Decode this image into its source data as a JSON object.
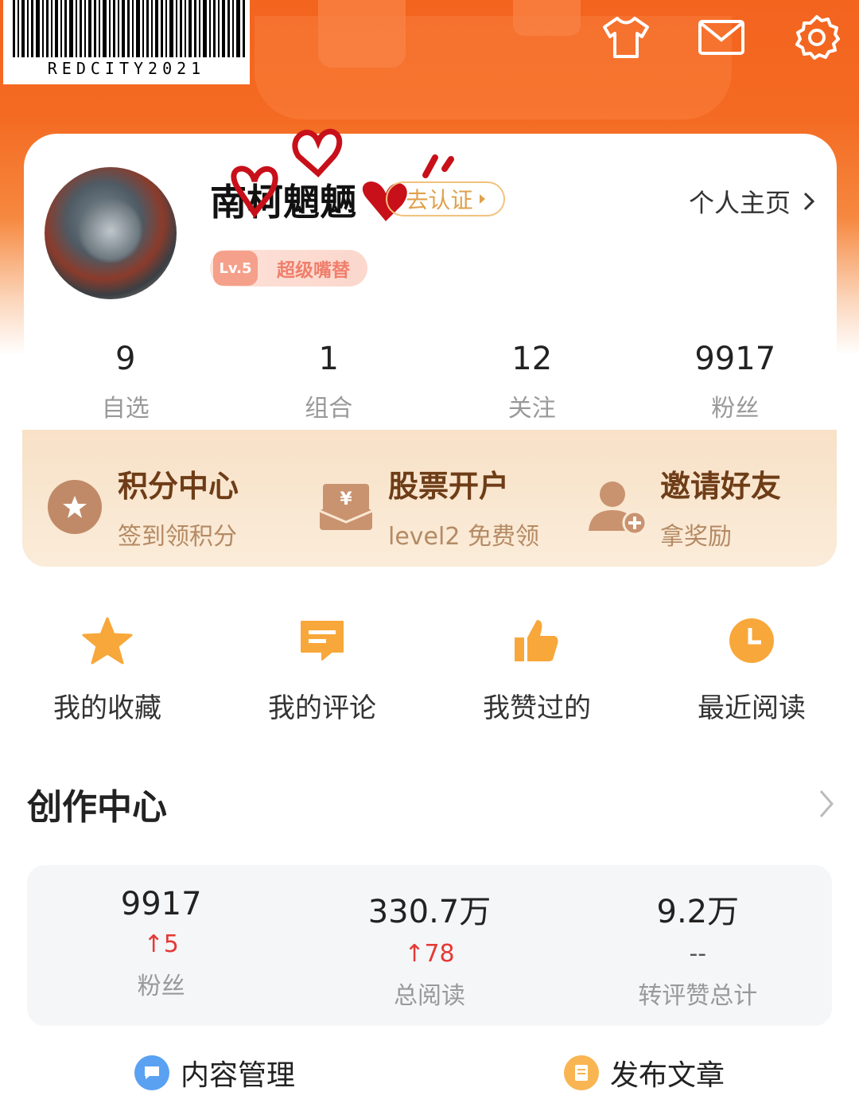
{
  "barcode": {
    "text": "REDCITY2021"
  },
  "header": {
    "icons": [
      "shirt-icon",
      "mail-icon",
      "settings-icon"
    ]
  },
  "profile": {
    "name": "南柯魍魉",
    "verify_label": "去认证",
    "homepage_label": "个人主页",
    "level": "Lv.5",
    "level_title": "超级嘴替"
  },
  "stats": [
    {
      "value": "9",
      "label": "自选"
    },
    {
      "value": "1",
      "label": "组合"
    },
    {
      "value": "12",
      "label": "关注"
    },
    {
      "value": "9917",
      "label": "粉丝"
    }
  ],
  "promos": [
    {
      "title": "积分中心",
      "subtitle": "签到领积分"
    },
    {
      "title": "股票开户",
      "subtitle": "level2 免费领"
    },
    {
      "title": "邀请好友",
      "subtitle": "拿奖励"
    }
  ],
  "quick_actions": [
    {
      "label": "我的收藏",
      "icon": "star-icon"
    },
    {
      "label": "我的评论",
      "icon": "comment-icon"
    },
    {
      "label": "我赞过的",
      "icon": "thumbs-up-icon"
    },
    {
      "label": "最近阅读",
      "icon": "clock-icon"
    }
  ],
  "creation": {
    "title": "创作中心",
    "stats": [
      {
        "value": "9917",
        "delta": "5",
        "label": "粉丝"
      },
      {
        "value": "330.7万",
        "delta": "78",
        "label": "总阅读"
      },
      {
        "value": "9.2万",
        "delta": "--",
        "label": "转评赞总计"
      }
    ]
  },
  "bottom_actions": [
    {
      "label": "内容管理"
    },
    {
      "label": "发布文章"
    }
  ],
  "colors": {
    "brand_orange": "#f3641f",
    "delta_up": "#e53935",
    "promo_text": "#6e3d17"
  }
}
